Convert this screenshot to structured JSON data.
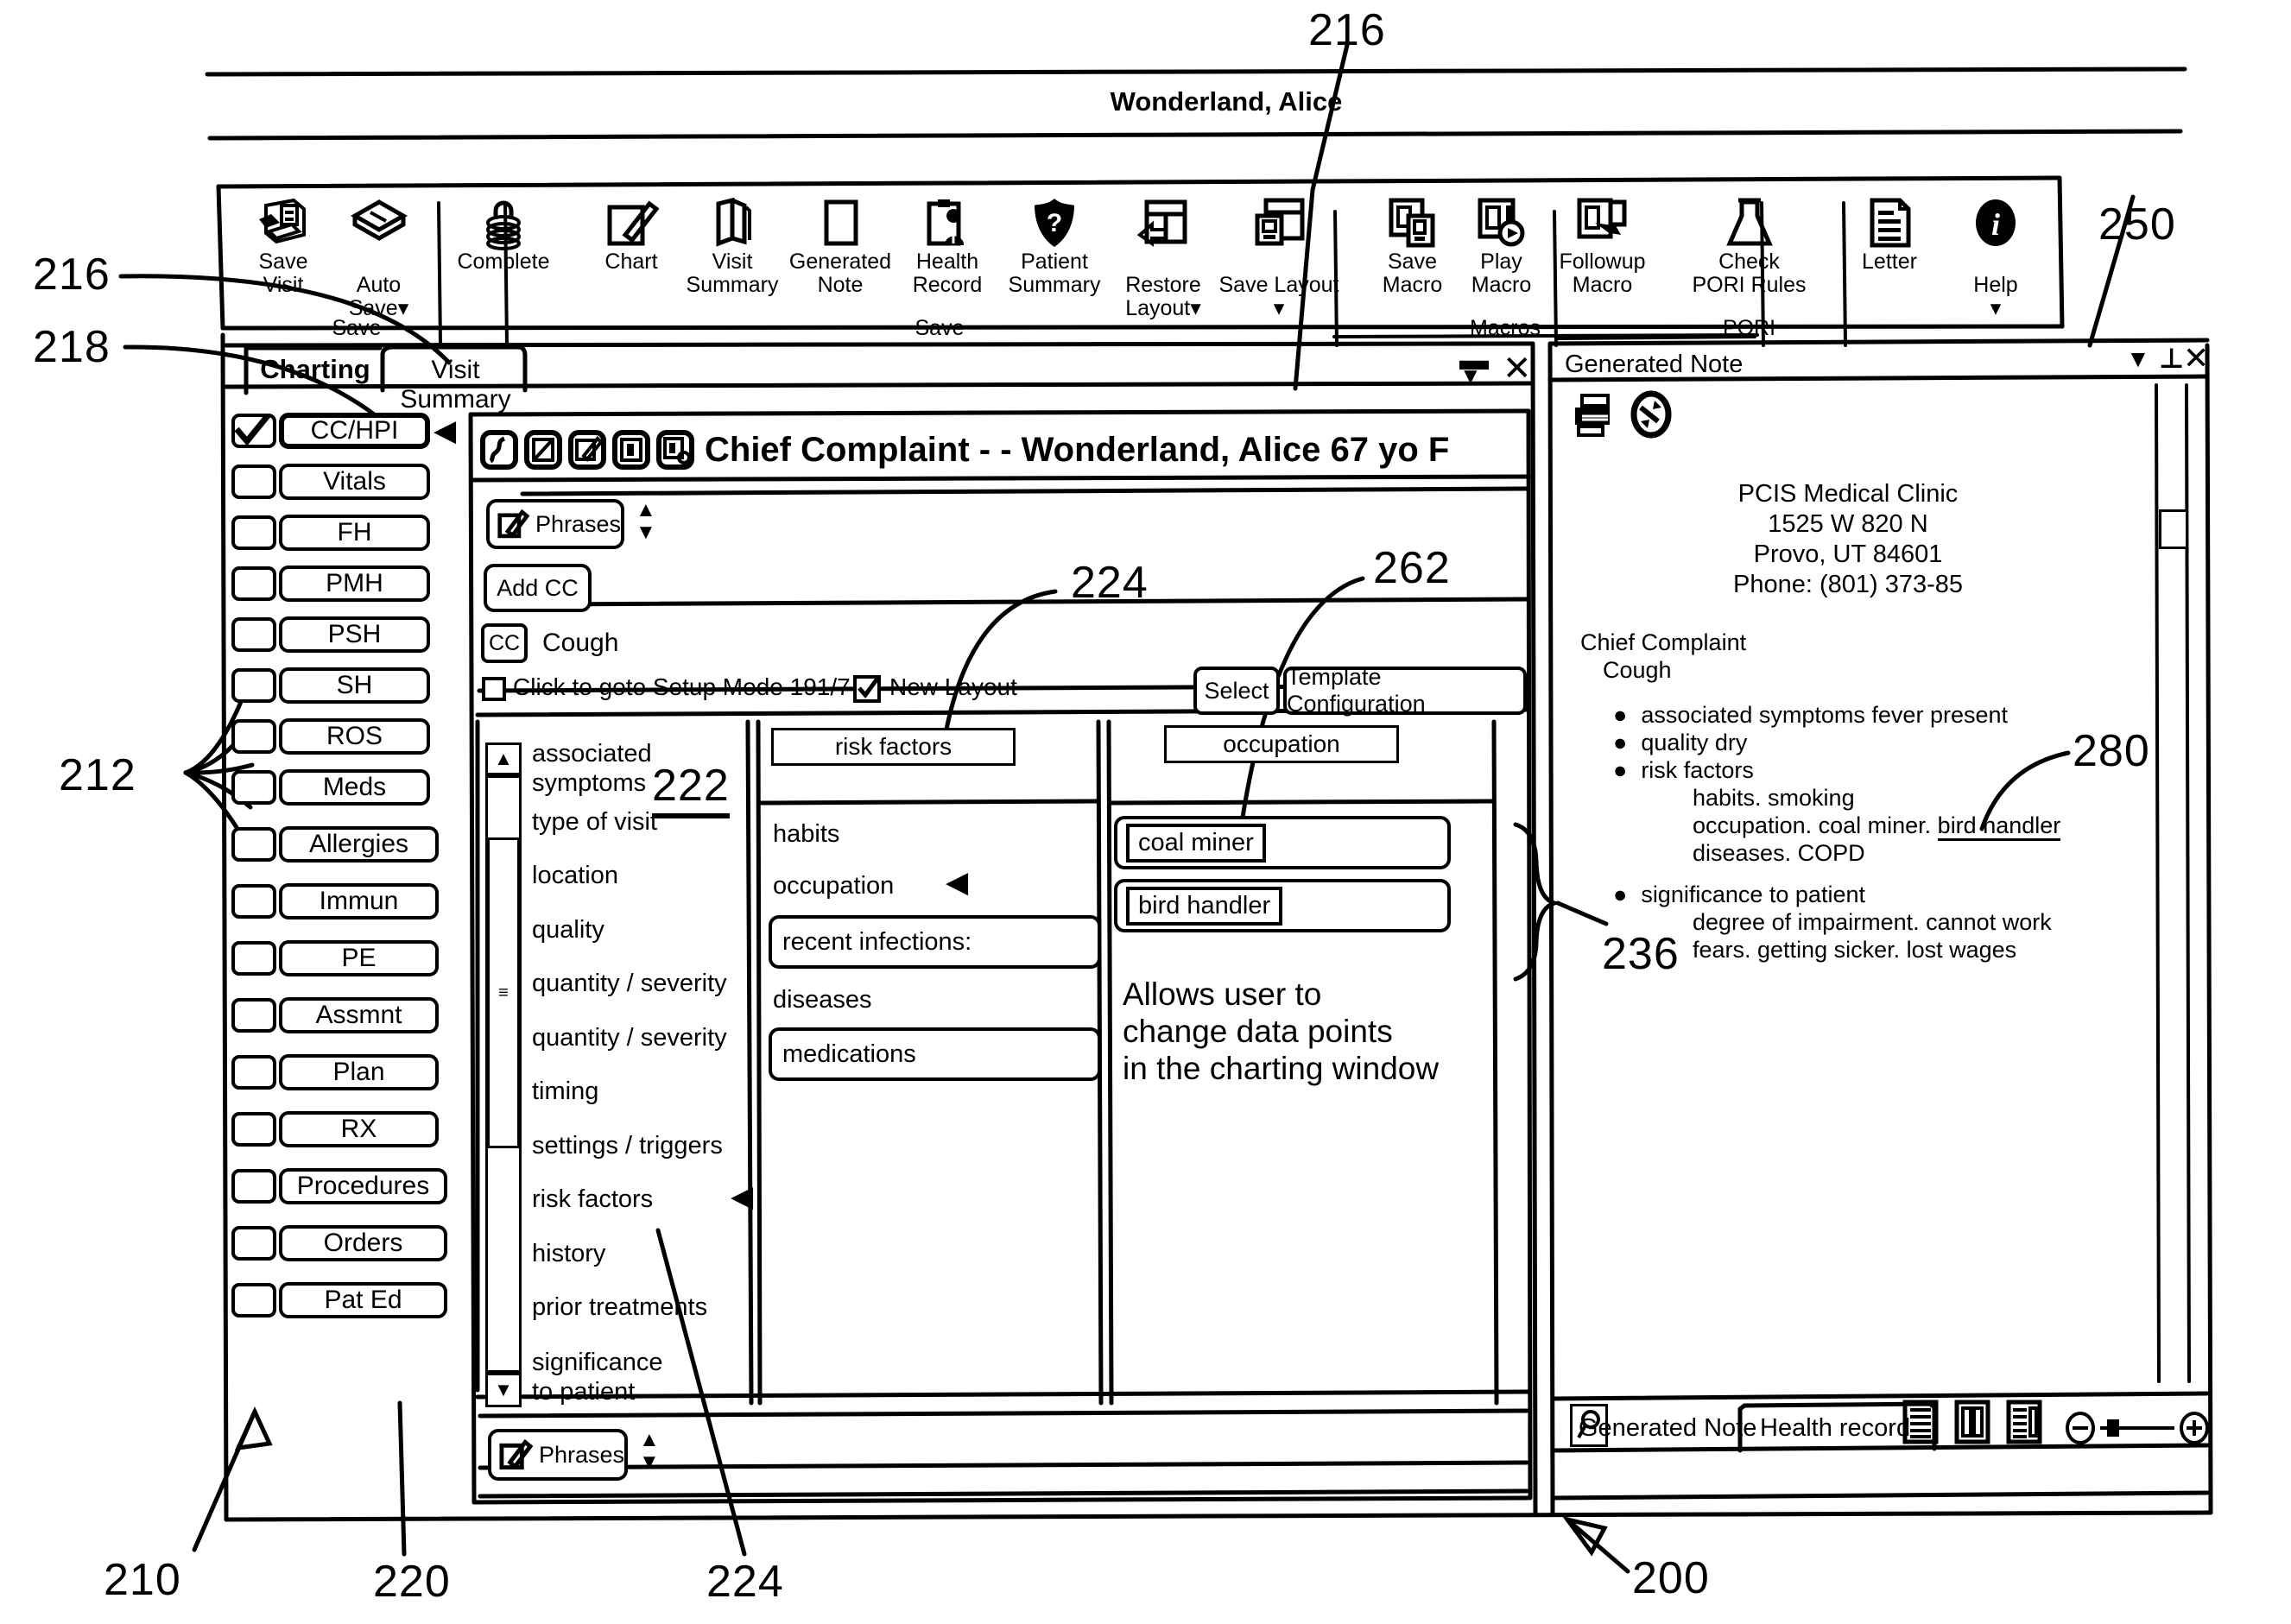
{
  "figure": {
    "patient_banner": "Wonderland, Alice",
    "reference_numerals": [
      {
        "id": "216-top",
        "label": "216"
      },
      {
        "id": "216-left",
        "label": "216"
      },
      {
        "id": "218",
        "label": "218"
      },
      {
        "id": "212",
        "label": "212"
      },
      {
        "id": "210",
        "label": "210"
      },
      {
        "id": "220",
        "label": "220"
      },
      {
        "id": "224-bottom",
        "label": "224"
      },
      {
        "id": "224-top",
        "label": "224"
      },
      {
        "id": "222",
        "label": "222"
      },
      {
        "id": "262",
        "label": "262"
      },
      {
        "id": "236",
        "label": "236"
      },
      {
        "id": "250",
        "label": "250"
      },
      {
        "id": "280",
        "label": "280"
      },
      {
        "id": "200",
        "label": "200"
      }
    ],
    "annotation_note": "Allows user to\nchange data points\nin the charting window"
  },
  "ribbon": {
    "groups": [
      {
        "name": "Save",
        "caption": "Save",
        "items": [
          {
            "label": "Save\nVisit",
            "icon": "save-visit-icon",
            "dropdown": false
          },
          {
            "label": "Auto\nSave",
            "icon": "auto-save-icon",
            "dropdown": true
          }
        ]
      },
      {
        "name": "Complete",
        "caption": "",
        "items": [
          {
            "label": "Complete",
            "icon": "lock-icon",
            "dropdown": false
          }
        ]
      },
      {
        "name": "Documents",
        "caption": "Save",
        "items": [
          {
            "label": "Chart",
            "icon": "chart-edit-icon",
            "dropdown": false
          },
          {
            "label": "Visit\nSummary",
            "icon": "book-icon",
            "dropdown": false
          },
          {
            "label": "Generated\nNote",
            "icon": "page-icon",
            "dropdown": false
          },
          {
            "label": "Health\nRecord",
            "icon": "clipboard-person-icon",
            "dropdown": false
          },
          {
            "label": "Patient\nSummary",
            "icon": "shield-question-icon",
            "dropdown": false
          },
          {
            "label": "Restore\nLayout",
            "icon": "restore-layout-icon",
            "dropdown": true
          },
          {
            "label": "Save Layout",
            "icon": "save-layout-icon",
            "dropdown": true
          }
        ]
      },
      {
        "name": "Macros",
        "caption": "Macros",
        "items": [
          {
            "label": "Save\nMacro",
            "icon": "save-macro-icon",
            "dropdown": false
          },
          {
            "label": "Play\nMacro",
            "icon": "play-macro-icon",
            "dropdown": false
          },
          {
            "label": "Followup\nMacro",
            "icon": "followup-macro-icon",
            "dropdown": false
          }
        ]
      },
      {
        "name": "PORI",
        "caption": "PORI",
        "items": [
          {
            "label": "Check\nPORI Rules",
            "icon": "flask-icon",
            "dropdown": false
          }
        ]
      },
      {
        "name": "Letter",
        "caption": "",
        "items": [
          {
            "label": "Letter",
            "icon": "letter-icon",
            "dropdown": false
          }
        ]
      },
      {
        "name": "Help",
        "caption": "",
        "items": [
          {
            "label": "Help",
            "icon": "info-icon",
            "dropdown": true
          }
        ]
      }
    ]
  },
  "charting_window": {
    "tabs": [
      {
        "label": "Charting",
        "active": true
      },
      {
        "label": "Visit Summary",
        "active": false
      }
    ],
    "titlebar_buttons": [
      "minimize-icon",
      "close-icon"
    ],
    "sidebar": {
      "items": [
        {
          "label": "CC/HPI",
          "checked": true,
          "selected": true
        },
        {
          "label": "Vitals",
          "checked": false,
          "selected": false
        },
        {
          "label": "FH",
          "checked": false,
          "selected": false
        },
        {
          "label": "PMH",
          "checked": false,
          "selected": false
        },
        {
          "label": "PSH",
          "checked": false,
          "selected": false
        },
        {
          "label": "SH",
          "checked": false,
          "selected": false
        },
        {
          "label": "ROS",
          "checked": false,
          "selected": false
        },
        {
          "label": "Meds",
          "checked": false,
          "selected": false
        },
        {
          "label": "Allergies",
          "checked": false,
          "selected": false
        },
        {
          "label": "Immun",
          "checked": false,
          "selected": false
        },
        {
          "label": "PE",
          "checked": false,
          "selected": false
        },
        {
          "label": "Assmnt",
          "checked": false,
          "selected": false
        },
        {
          "label": "Plan",
          "checked": false,
          "selected": false
        },
        {
          "label": "RX",
          "checked": false,
          "selected": false
        },
        {
          "label": "Procedures",
          "checked": false,
          "selected": false
        },
        {
          "label": "Orders",
          "checked": false,
          "selected": false
        },
        {
          "label": "Pat Ed",
          "checked": false,
          "selected": false
        }
      ]
    }
  },
  "cc_window": {
    "title": "Chief Complaint - - Wonderland, Alice 67 yo F",
    "title_icons": [
      "signature-icon",
      "no-edit-icon",
      "edit-note-icon",
      "single-pane-icon",
      "search-pane-icon"
    ],
    "phrases_button_top": "Phrases",
    "phrases_button_bottom": "Phrases",
    "add_cc_button": "Add CC",
    "cc_tag": "CC",
    "cc_value": "Cough",
    "setup_mode_checkbox": {
      "label": "Click to goto Setup Mode 191/7",
      "checked": false
    },
    "new_layout_checkbox": {
      "label": "New Layout",
      "checked": true
    },
    "select_button": "Select",
    "template_config_button": "Template Configuration",
    "data_point_list": [
      "associated symptoms",
      "type of visit",
      "location",
      "quality",
      "quantity / severity",
      "quantity / severity",
      "timing",
      "settings / triggers",
      "risk factors",
      "history",
      "prior treatments",
      "significance to patient"
    ],
    "data_point_selected": "risk factors",
    "middle_panel": {
      "header": "risk factors",
      "items": [
        {
          "label": "habits",
          "boxed": false,
          "selected": false
        },
        {
          "label": "occupation",
          "boxed": false,
          "selected": true
        },
        {
          "label": "recent infections:",
          "boxed": true,
          "selected": false
        },
        {
          "label": "diseases",
          "boxed": false,
          "selected": false
        },
        {
          "label": "medications",
          "boxed": true,
          "selected": false
        }
      ]
    },
    "right_panel": {
      "header": "occupation",
      "items": [
        {
          "label": "coal miner",
          "boxed": true
        },
        {
          "label": "bird handler",
          "boxed": true
        }
      ]
    }
  },
  "generated_note_window": {
    "title": "Generated Note",
    "titlebar_buttons": [
      "dropdown-icon",
      "pin-icon",
      "close-icon"
    ],
    "toolbar_icons": [
      "print-icon",
      "refresh-icon"
    ],
    "clinic": {
      "name": "PCIS Medical Clinic",
      "address1": "1525 W 820 N",
      "address2": "Provo, UT 84601",
      "phone": "Phone: (801) 373-85"
    },
    "note": {
      "heading": "Chief Complaint",
      "subheading": "Cough",
      "bullets": [
        {
          "text": "associated symptoms fever present",
          "sub": []
        },
        {
          "text": "quality dry",
          "sub": []
        },
        {
          "text": "risk factors",
          "sub": [
            "habits. smoking",
            "occupation. coal miner. bird handler",
            "diseases. COPD"
          ]
        },
        {
          "text": "significance to patient",
          "sub": [
            "degree of impairment. cannot work",
            "fears. getting sicker. lost wages"
          ]
        }
      ],
      "underlined_phrase": "bird handler"
    },
    "bottom_toolbar_icons": [
      "find-icon",
      "single-column-icon",
      "two-column-icon",
      "mixed-column-icon",
      "zoom-out-icon",
      "zoom-slider",
      "zoom-in-icon"
    ],
    "tabs": [
      {
        "label": "Generated Note",
        "active": true
      },
      {
        "label": "Health record",
        "active": false
      }
    ]
  }
}
